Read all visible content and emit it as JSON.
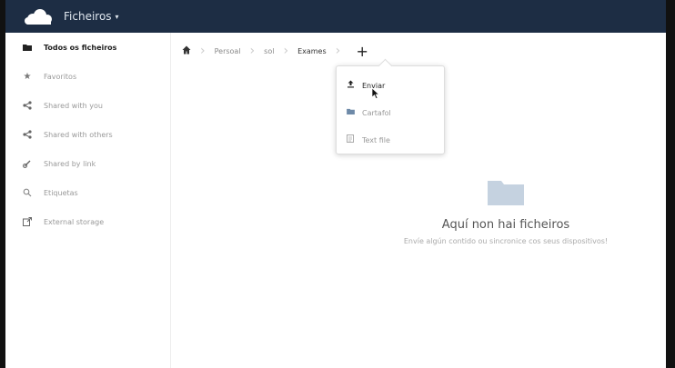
{
  "header": {
    "app_name": "Ficheiros",
    "caret": "▾"
  },
  "sidebar": {
    "items": [
      {
        "label": "Todos os ficheiros",
        "icon": "folder-icon",
        "active": true
      },
      {
        "label": "Favoritos",
        "icon": "star-icon"
      },
      {
        "label": "Shared with you",
        "icon": "share-icon"
      },
      {
        "label": "Shared with others",
        "icon": "share-icon"
      },
      {
        "label": "Shared by link",
        "icon": "link-icon"
      },
      {
        "label": "Etiquetas",
        "icon": "tag-icon"
      },
      {
        "label": "External storage",
        "icon": "external-icon"
      }
    ]
  },
  "breadcrumb": {
    "items": [
      "Persoal",
      "sol",
      "Exames"
    ]
  },
  "new_menu": {
    "items": [
      {
        "label": "Enviar",
        "icon": "upload-icon"
      },
      {
        "label": "Cartafol",
        "icon": "folder-icon"
      },
      {
        "label": "Text file",
        "icon": "file-icon"
      }
    ]
  },
  "empty_state": {
    "title": "Aquí non hai ficheiros",
    "subtitle": "Envíe algún contido ou sincronice cos seus dispositivos!"
  },
  "colors": {
    "topbar": "#1d2d44",
    "folder": "#c5d2e0"
  }
}
